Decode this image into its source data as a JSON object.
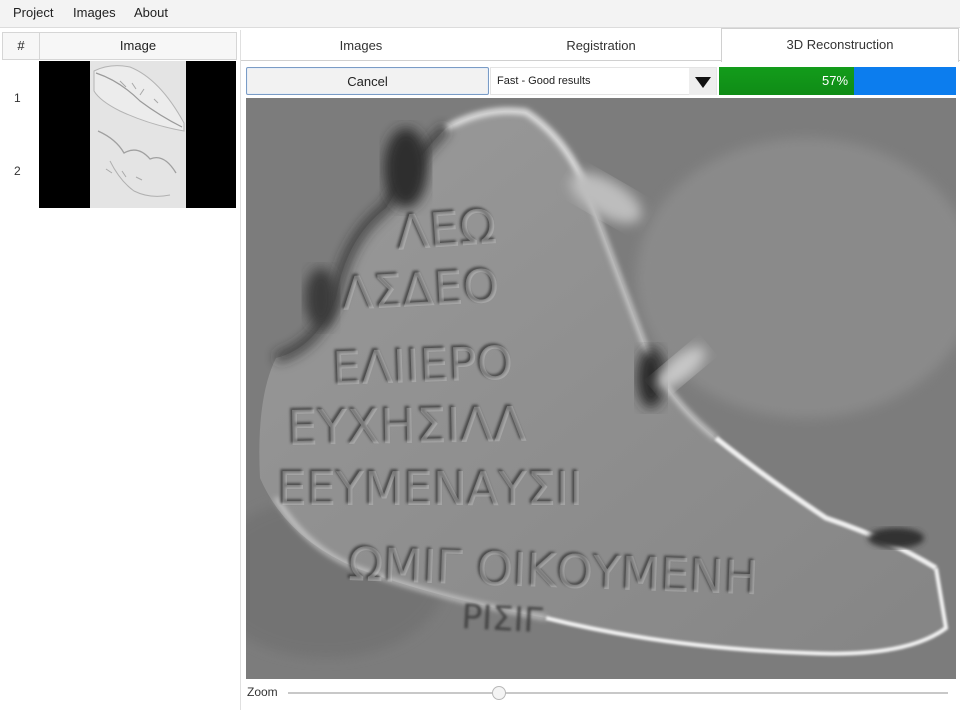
{
  "menu": {
    "items": [
      "Project",
      "Images",
      "About"
    ]
  },
  "image_table": {
    "headers": {
      "num": "#",
      "image": "Image"
    },
    "rows": [
      {
        "num": "1"
      },
      {
        "num": "2"
      }
    ]
  },
  "tabs": {
    "items": [
      "Images",
      "Registration",
      "3D Reconstruction"
    ],
    "active": "3D Reconstruction"
  },
  "toolbar": {
    "cancel_label": "Cancel",
    "quality_select": "Fast - Good results",
    "progress": {
      "value": 0.57,
      "label": "57%",
      "fill_color": "#0f8c16",
      "track_color": "#0c7dee"
    }
  },
  "zoom": {
    "label": "Zoom",
    "level": 0.32
  },
  "icons": {
    "select_arrow": "triangle-down-icon"
  }
}
